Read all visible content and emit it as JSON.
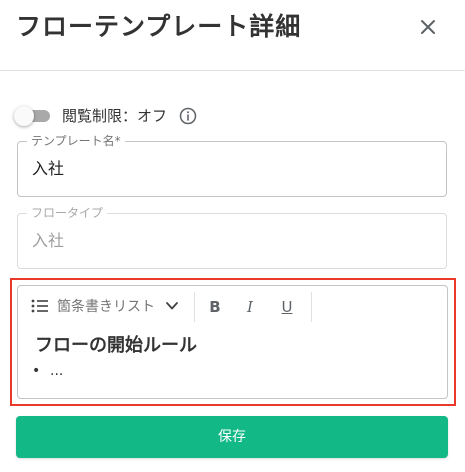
{
  "header": {
    "title": "フローテンプレート詳細",
    "close_icon": "close-icon"
  },
  "access_restriction": {
    "label": "閲覧制限：オフ",
    "enabled": false,
    "info_icon": "info-icon"
  },
  "template_name": {
    "label": "テンプレート名*",
    "value": "入社"
  },
  "flow_type": {
    "label": "フロータイプ",
    "value": "入社",
    "disabled": true
  },
  "editor": {
    "toolbar": {
      "list_icon": "bulleted-list-icon",
      "format_label": "箇条書きリスト",
      "chevron_icon": "chevron-down-icon",
      "bold": "B",
      "italic": "I",
      "underline": "U"
    },
    "heading": "フローの開始ルール",
    "bullet_marker": "•",
    "bullet_items": [
      "..."
    ]
  },
  "save_button": {
    "label": "保存"
  },
  "colors": {
    "accent": "#12b886",
    "highlight_border": "#e8392a",
    "toggle_off": "#a9a9a9"
  }
}
